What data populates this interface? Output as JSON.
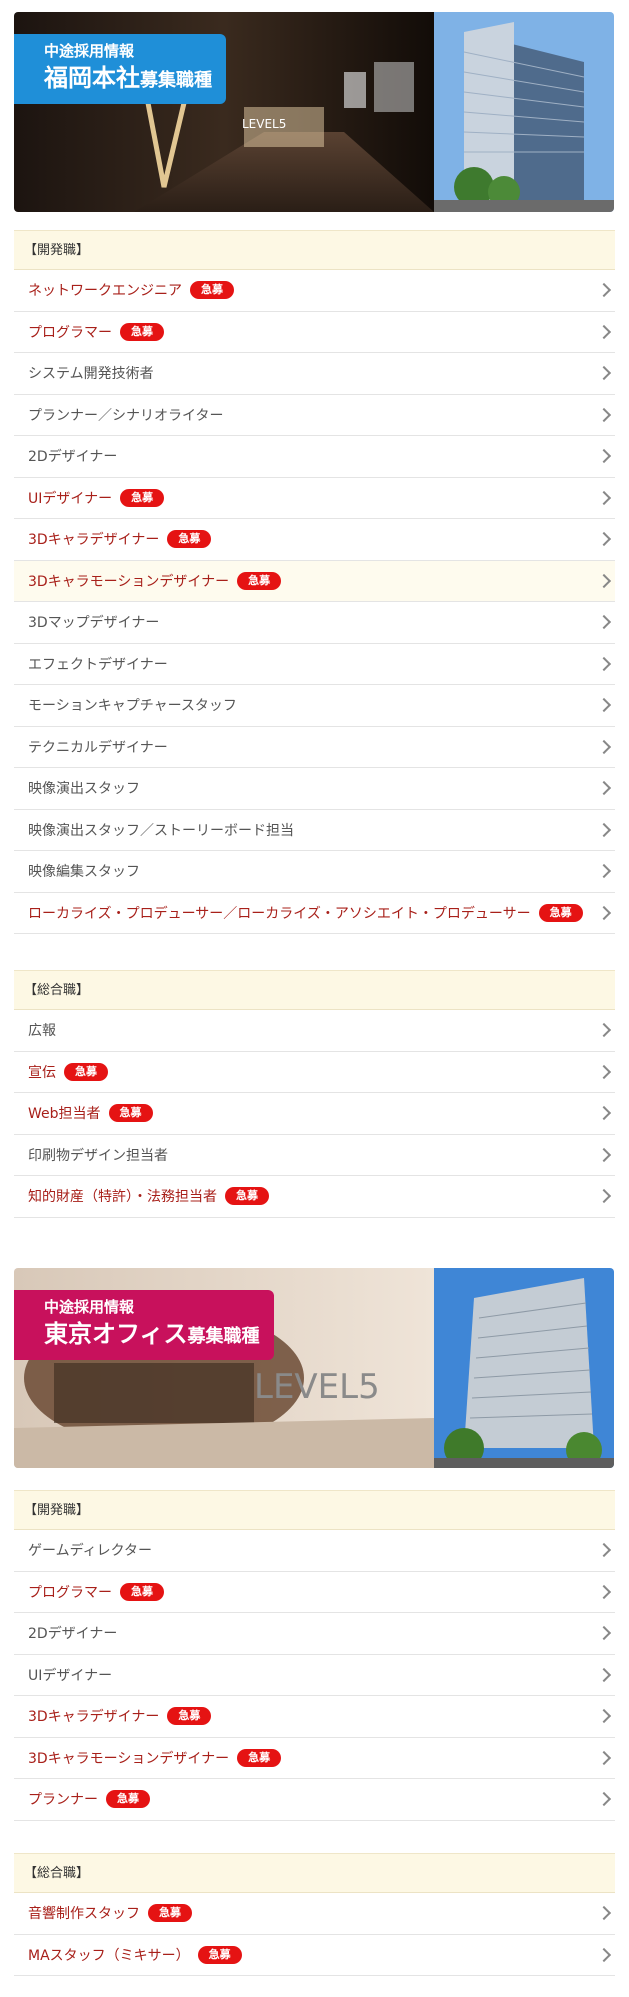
{
  "fukuoka": {
    "banner": {
      "sub": "中途採用情報",
      "main": "福岡本社",
      "main_small": "募集職種",
      "color": "#1f8fd8"
    },
    "sections": [
      {
        "title": "【開発職】",
        "items": [
          {
            "label": "ネットワークエンジニア",
            "badge": "急募"
          },
          {
            "label": "プログラマー",
            "badge": "急募"
          },
          {
            "label": "システム開発技術者",
            "badge": null
          },
          {
            "label": "プランナー／シナリオライター",
            "badge": null
          },
          {
            "label": "2Dデザイナー",
            "badge": null
          },
          {
            "label": "UIデザイナー",
            "badge": "急募"
          },
          {
            "label": "3Dキャラデザイナー",
            "badge": "急募"
          },
          {
            "label": "3Dキャラモーションデザイナー",
            "badge": "急募",
            "highlight": true
          },
          {
            "label": "3Dマップデザイナー",
            "badge": null
          },
          {
            "label": "エフェクトデザイナー",
            "badge": null
          },
          {
            "label": "モーションキャプチャースタッフ",
            "badge": null
          },
          {
            "label": "テクニカルデザイナー",
            "badge": null
          },
          {
            "label": "映像演出スタッフ",
            "badge": null
          },
          {
            "label": "映像演出スタッフ／ストーリーボード担当",
            "badge": null
          },
          {
            "label": "映像編集スタッフ",
            "badge": null
          },
          {
            "label": "ローカライズ・プロデューサー／ローカライズ・アソシエイト・プロデューサー",
            "badge": "急募"
          }
        ]
      },
      {
        "title": "【総合職】",
        "items": [
          {
            "label": "広報",
            "badge": null
          },
          {
            "label": "宣伝",
            "badge": "急募"
          },
          {
            "label": "Web担当者",
            "badge": "急募"
          },
          {
            "label": "印刷物デザイン担当者",
            "badge": null
          },
          {
            "label": "知的財産（特許）・法務担当者",
            "badge": "急募"
          }
        ]
      }
    ]
  },
  "tokyo": {
    "banner": {
      "sub": "中途採用情報",
      "main": "東京オフィス",
      "main_small": "募集職種",
      "color": "#c8115c",
      "logo_text": "LEVEL5"
    },
    "sections": [
      {
        "title": "【開発職】",
        "items": [
          {
            "label": "ゲームディレクター",
            "badge": null
          },
          {
            "label": "プログラマー",
            "badge": "急募"
          },
          {
            "label": "2Dデザイナー",
            "badge": null
          },
          {
            "label": "UIデザイナー",
            "badge": null
          },
          {
            "label": "3Dキャラデザイナー",
            "badge": "急募"
          },
          {
            "label": "3Dキャラモーションデザイナー",
            "badge": "急募"
          },
          {
            "label": "プランナー",
            "badge": "急募"
          }
        ]
      },
      {
        "title": "【総合職】",
        "items": [
          {
            "label": "音響制作スタッフ",
            "badge": "急募"
          },
          {
            "label": "MAスタッフ（ミキサー）",
            "badge": "急募"
          }
        ]
      }
    ]
  },
  "colors": {
    "accent_red": "#a8201a",
    "badge_red": "#e51313",
    "section_bg": "#fdf8e4"
  }
}
